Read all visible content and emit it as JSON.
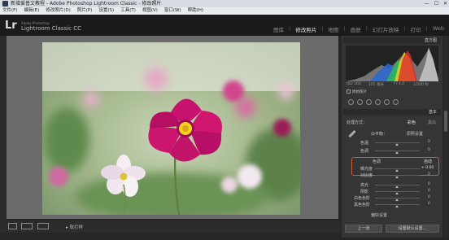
{
  "window": {
    "title": "新增爱普文教程 - Adobe Photoshop Lightroom Classic - 修改照片",
    "controls": [
      "—",
      "☐",
      "✕"
    ]
  },
  "menu": [
    "文件(F)",
    "编辑(E)",
    "修改照片(D)",
    "照片(P)",
    "设置(S)",
    "工具(T)",
    "视图(V)",
    "窗口(W)",
    "帮助(H)"
  ],
  "identity": {
    "logo": "Lr",
    "small": "Adobe Photoshop",
    "name": "Lightroom Classic CC"
  },
  "modules": [
    {
      "label": "图库",
      "active": false
    },
    {
      "label": "修改照片",
      "active": true
    },
    {
      "label": "地图",
      "active": false
    },
    {
      "label": "画册",
      "active": false
    },
    {
      "label": "幻灯片放映",
      "active": false
    },
    {
      "label": "打印",
      "active": false
    },
    {
      "label": "Web",
      "active": false
    }
  ],
  "right_panel": {
    "histogram_header": "直方图",
    "histo_iso": "ISO 160",
    "histo_focal": "105 毫米",
    "histo_aperture": "f / 4.0",
    "histo_shutter": "1/500 秒",
    "original_photo": "原始照片",
    "basic_header": "基本",
    "treatment_label": "处理方式：",
    "color": "彩色",
    "bw": "黑白",
    "profile_label": "配置文件：",
    "profile_value": "颜色",
    "wb_label": "白平衡：",
    "wb_value": "原照设置",
    "temp_label": "色温",
    "temp_value": "0",
    "tint_label": "色调",
    "tint_value": "0",
    "tone_label": "色调",
    "tone_auto": "自动",
    "exposure_label": "曝光度",
    "exposure_value": "+ 0.00",
    "contrast_label": "对比度",
    "contrast_value": "0",
    "highlights_label": "高光",
    "highlights_value": "0",
    "shadows_label": "阴影",
    "shadows_value": "0",
    "whites_label": "白色色阶",
    "whites_value": "0",
    "blacks_label": "黑色色阶",
    "blacks_value": "0",
    "presence_label": "偏好设置",
    "prev_button": "上一张",
    "reset_button": "设置默认设置..."
  },
  "toolbar": {
    "label": "▸ 软打样"
  },
  "colors": {
    "accent_red": "#d05a3a",
    "flower_main": "#c8126e",
    "flower_center": "#f2d21a"
  }
}
